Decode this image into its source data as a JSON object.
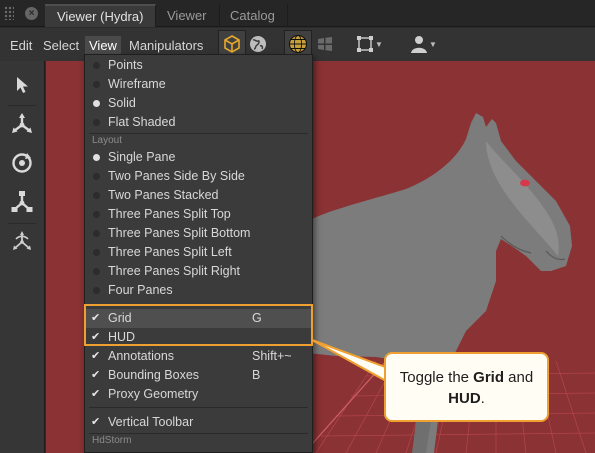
{
  "tabs": [
    {
      "label": "Viewer (Hydra)",
      "active": true
    },
    {
      "label": "Viewer",
      "active": false
    },
    {
      "label": "Catalog",
      "active": false
    }
  ],
  "menubar": {
    "items": [
      "Edit",
      "Select",
      "View",
      "Manipulators"
    ],
    "open_menu": "View"
  },
  "view_menu": {
    "display_modes": [
      {
        "label": "Points",
        "selected": false
      },
      {
        "label": "Wireframe",
        "selected": false
      },
      {
        "label": "Solid",
        "selected": true
      },
      {
        "label": "Flat Shaded",
        "selected": false
      }
    ],
    "layout_section": "Layout",
    "layouts": [
      {
        "label": "Single Pane",
        "selected": true
      },
      {
        "label": "Two Panes Side By Side",
        "selected": false
      },
      {
        "label": "Two Panes Stacked",
        "selected": false
      },
      {
        "label": "Three Panes Split Top",
        "selected": false
      },
      {
        "label": "Three Panes Split Bottom",
        "selected": false
      },
      {
        "label": "Three Panes Split Left",
        "selected": false
      },
      {
        "label": "Three Panes Split Right",
        "selected": false
      },
      {
        "label": "Four Panes",
        "selected": false
      }
    ],
    "toggles": [
      {
        "label": "Grid",
        "shortcut": "G",
        "checked": true
      },
      {
        "label": "HUD",
        "shortcut": "",
        "checked": true
      },
      {
        "label": "Annotations",
        "shortcut": "Shift+~",
        "checked": true
      },
      {
        "label": "Bounding Boxes",
        "shortcut": "B",
        "checked": true
      },
      {
        "label": "Proxy Geometry",
        "shortcut": "",
        "checked": true
      }
    ],
    "vertical_toolbar": {
      "label": "Vertical Toolbar",
      "checked": true
    },
    "hdstorm_section": "HdStorm"
  },
  "callout": {
    "prefix": "Toggle the ",
    "grid": "Grid",
    "middle": " and",
    "hud": "HUD",
    "suffix": "."
  },
  "colors": {
    "accent": "#f0a030",
    "viewport_bg": "#8a3234",
    "callout_bg": "#fffdf4"
  },
  "icons": {
    "toolbar": [
      "cube-icon",
      "globe-icon",
      "wireframe-globe-icon",
      "windows-icon",
      "transform-box-icon",
      "user-icon"
    ],
    "left_toolbar": [
      "select-arrow-icon",
      "translate-icon",
      "rotate-icon",
      "scale-icon",
      "pivot-icon"
    ]
  }
}
